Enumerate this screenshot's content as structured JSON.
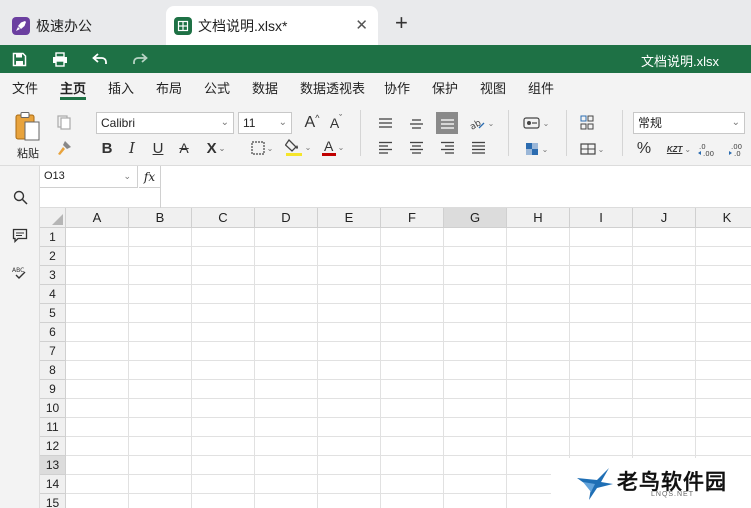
{
  "tabs": [
    {
      "label": "极速办公",
      "icon": "rocket-icon"
    },
    {
      "label": "文档说明.xlsx*",
      "icon": "spreadsheet-icon",
      "active": true
    }
  ],
  "new_tab_label": "+",
  "close_label": "✕",
  "document_title": "文档说明.xlsx",
  "menu": [
    "文件",
    "主页",
    "插入",
    "布局",
    "公式",
    "数据",
    "数据透视表",
    "协作",
    "保护",
    "视图",
    "组件"
  ],
  "active_menu": "主页",
  "ribbon": {
    "paste_label": "粘贴",
    "font_name": "Calibri",
    "font_size": "11",
    "number_format": "常规",
    "bold": "B",
    "italic": "I",
    "underline": "U",
    "strike": "A",
    "subscript": "X",
    "font_color_letter": "A",
    "grow_font": "A",
    "shrink_font": "A",
    "percent": "%",
    "currency_glyph": "KZT"
  },
  "formula_bar": {
    "cell_ref": "O13",
    "fx_label": "fx",
    "formula": ""
  },
  "columns": [
    "A",
    "B",
    "C",
    "D",
    "E",
    "F",
    "G",
    "H",
    "I",
    "J",
    "K"
  ],
  "selected_column": "G",
  "rows": [
    "1",
    "2",
    "3",
    "4",
    "5",
    "6",
    "7",
    "8",
    "9",
    "10",
    "11",
    "12",
    "13",
    "14",
    "15"
  ],
  "selected_row": "13",
  "watermark": {
    "title": "老鸟软件园",
    "subtitle": "LNQS.NET"
  },
  "colors": {
    "accent": "#1e7145",
    "fill_color": "#f5e52a",
    "font_color": "#c00000"
  }
}
